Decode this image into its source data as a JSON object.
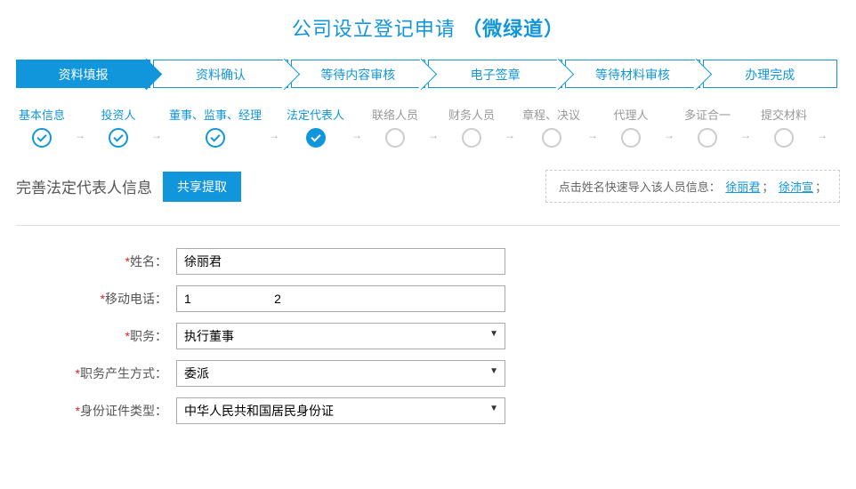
{
  "title_main": "公司设立登记申请",
  "title_suffix": "（微绿道）",
  "main_steps": [
    {
      "label": "资料填报",
      "active": true
    },
    {
      "label": "资料确认",
      "active": false
    },
    {
      "label": "等待内容审核",
      "active": false
    },
    {
      "label": "电子签章",
      "active": false
    },
    {
      "label": "等待材料审核",
      "active": false
    },
    {
      "label": "办理完成",
      "active": false
    }
  ],
  "sub_steps": [
    {
      "label": "基本信息",
      "state": "done"
    },
    {
      "label": "投资人",
      "state": "done"
    },
    {
      "label": "董事、监事、经理",
      "state": "done"
    },
    {
      "label": "法定代表人",
      "state": "current"
    },
    {
      "label": "联络人员",
      "state": "todo"
    },
    {
      "label": "财务人员",
      "state": "todo"
    },
    {
      "label": "章程、决议",
      "state": "todo"
    },
    {
      "label": "代理人",
      "state": "todo"
    },
    {
      "label": "多证合一",
      "state": "todo"
    },
    {
      "label": "提交材料",
      "state": "todo"
    }
  ],
  "section": {
    "title": "完善法定代表人信息",
    "extract_btn": "共享提取",
    "quick_import_prefix": "点击姓名快速导入该人员信息：",
    "quick_links": [
      "徐丽君",
      "徐沛宣"
    ]
  },
  "form": {
    "name": {
      "label": "姓名：",
      "value": "徐丽君"
    },
    "mobile": {
      "label": "移动电话：",
      "value": "1                        2"
    },
    "position": {
      "label": "职务：",
      "value": "执行董事"
    },
    "appoint_method": {
      "label": "职务产生方式：",
      "value": "委派"
    },
    "id_type": {
      "label": "身份证件类型：",
      "value": "中华人民共和国居民身份证"
    }
  }
}
